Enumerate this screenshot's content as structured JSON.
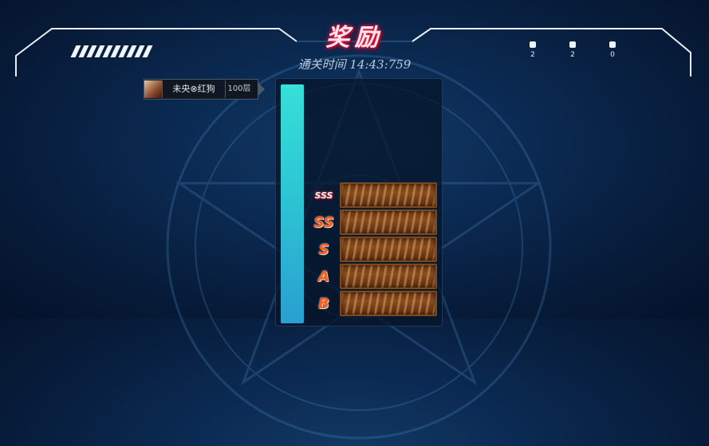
{
  "reward_screen": {
    "title": "奖励",
    "clear_time": "通关时间 14:43:759",
    "player": {
      "name": "未央⊗红狗",
      "floor": "100层"
    },
    "corner_counters": [
      "2",
      "2",
      "0"
    ],
    "progress": {
      "fill_fraction": 1.0
    },
    "rewards": [
      {
        "rank": "SSS",
        "item": "treasure-chest"
      },
      {
        "rank": "SS",
        "item": "treasure-chest"
      },
      {
        "rank": "S",
        "item": "treasure-chest"
      },
      {
        "rank": "A",
        "item": "treasure-chest"
      },
      {
        "rank": "B",
        "item": "treasure-chest"
      }
    ],
    "colors": {
      "background": "#0b2a52",
      "progress_fill": "#37e0d8",
      "rank_text": "#ff5a1a",
      "title_glow": "#ff2a55"
    }
  }
}
